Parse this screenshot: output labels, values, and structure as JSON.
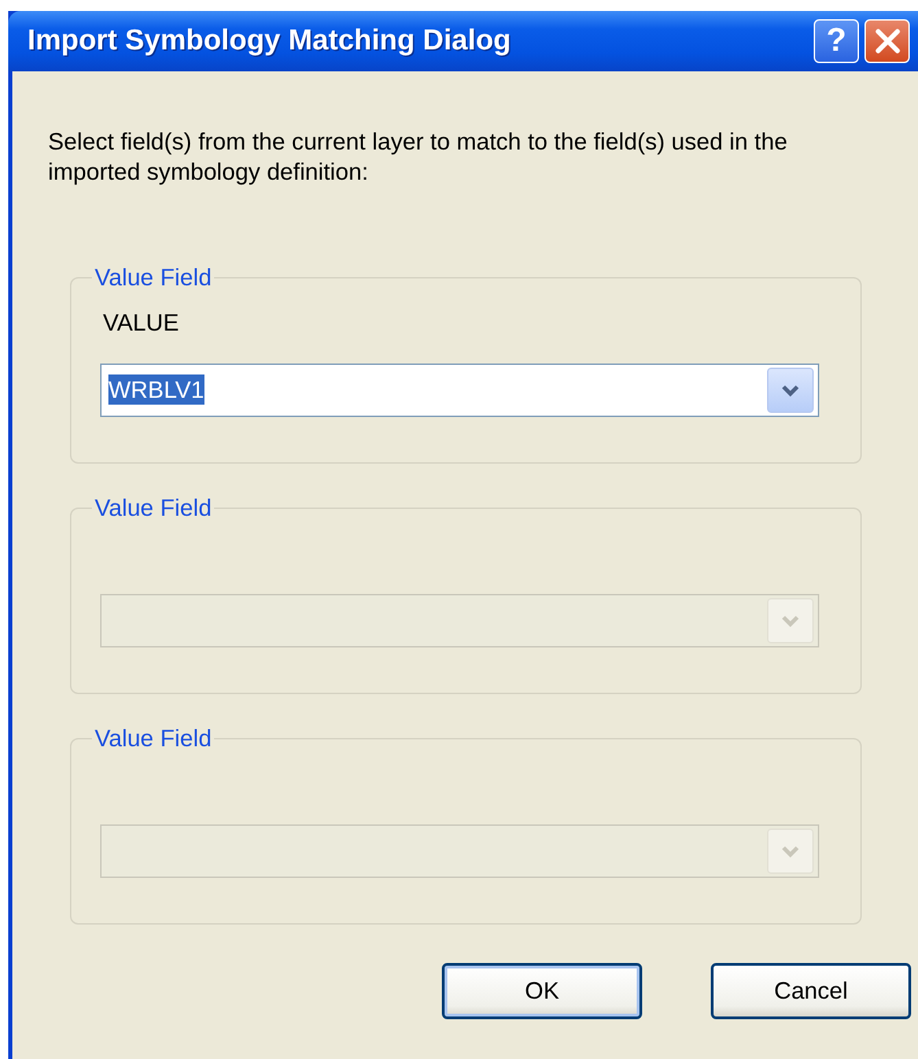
{
  "window": {
    "title": "Import Symbology Matching Dialog",
    "help_glyph": "?"
  },
  "instructions": "Select field(s) from the current layer to match to the field(s) used in the imported symbology definition:",
  "groups": [
    {
      "legend": "Value Field",
      "source_field": "VALUE",
      "combo": {
        "value": "WRBLV1",
        "highlighted": true,
        "disabled": false
      }
    },
    {
      "legend": "Value Field",
      "combo": {
        "disabled": true
      }
    },
    {
      "legend": "Value Field",
      "combo": {
        "disabled": true
      }
    }
  ],
  "buttons": [
    {
      "label": "OK",
      "default": true
    },
    {
      "label": "Cancel",
      "default": false
    }
  ]
}
